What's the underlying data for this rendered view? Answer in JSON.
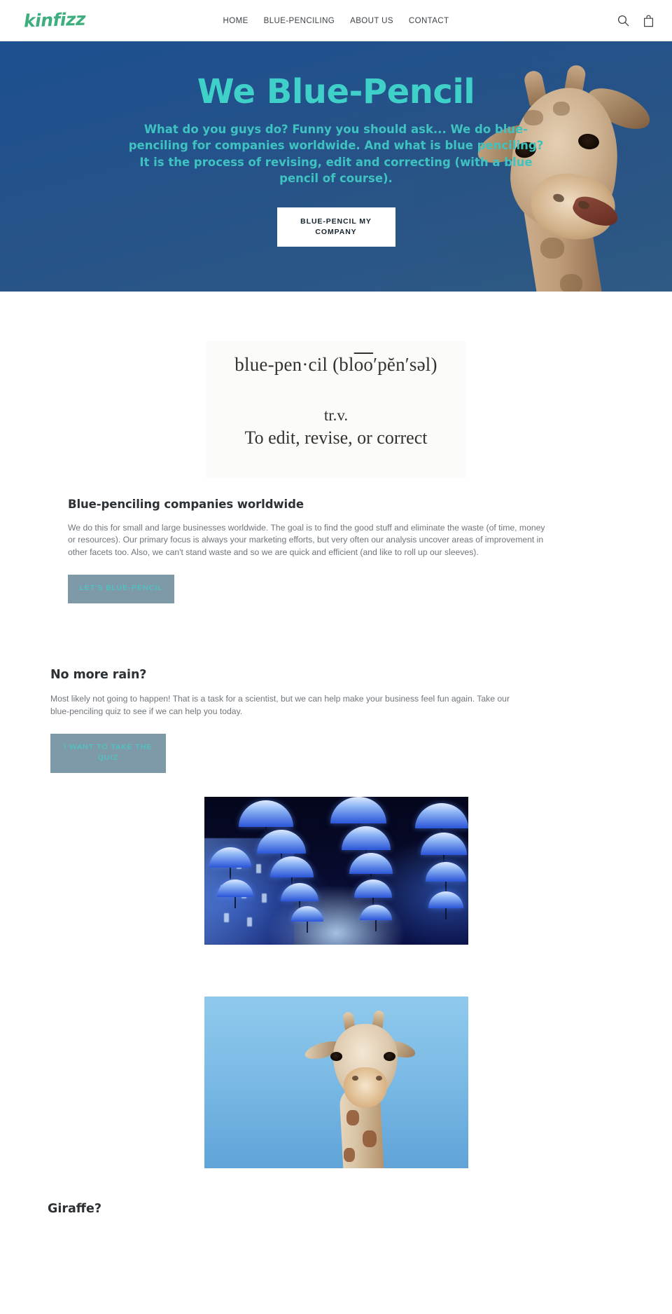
{
  "header": {
    "logo_text": "kinfizz",
    "nav": [
      {
        "label": "HOME"
      },
      {
        "label": "BLUE-PENCILING"
      },
      {
        "label": "ABOUT US"
      },
      {
        "label": "CONTACT"
      }
    ],
    "icons": {
      "search": "search-icon",
      "cart": "shopping-bag-icon"
    }
  },
  "hero": {
    "title": "We Blue-Pencil",
    "subtitle": "What do you guys do? Funny you should ask... We do blue-penciling for companies worldwide. And what is blue penciling? It is the process of revising, edit and correcting (with a blue pencil of course).",
    "cta_label": "BLUE-PENCIL MY COMPANY",
    "title_color": "#3fd0c9",
    "subtitle_color": "#3fc3c0",
    "background_color": "#23548c",
    "image_alt": "giraffe-head-photo"
  },
  "definition": {
    "term": "blue-pen·cil (bl",
    "term_macron": "oo",
    "term_rest": "′pĕn′səl)",
    "part_of_speech": "tr.v.",
    "meaning": "To edit, revise, or correct"
  },
  "sections": [
    {
      "heading": "Blue-penciling companies worldwide",
      "body": "We do this for small and large businesses worldwide. The goal is to find the good stuff and eliminate the waste (of time, money or resources). Our primary focus is always your marketing efforts, but very often our analysis uncover areas of improvement in other facets too. Also, we can't stand waste and so we are quick and efficient (and like to roll up our sleeves).",
      "cta_label": "LET'S BLUE-PENCIL"
    },
    {
      "heading": "No more rain?",
      "body": "Most likely not going to happen! That is a task for a scientist, but we can help make your business feel fun again. Take our blue-penciling quiz to see if we can help you today.",
      "cta_label": "I WANT TO TAKE THE QUIZ"
    }
  ],
  "images": {
    "umbrellas_alt": "blue-umbrellas-photo",
    "giraffe_alt": "giraffe-blue-sky-photo"
  },
  "bottom": {
    "heading": "Giraffe?"
  },
  "colors": {
    "brand_green": "#3fae7e",
    "accent_teal": "#3fd0c9",
    "hero_blue": "#23548c",
    "button_slate": "#7e9aa9",
    "body_text": "#6f767c",
    "heading_text": "#2c3135"
  }
}
